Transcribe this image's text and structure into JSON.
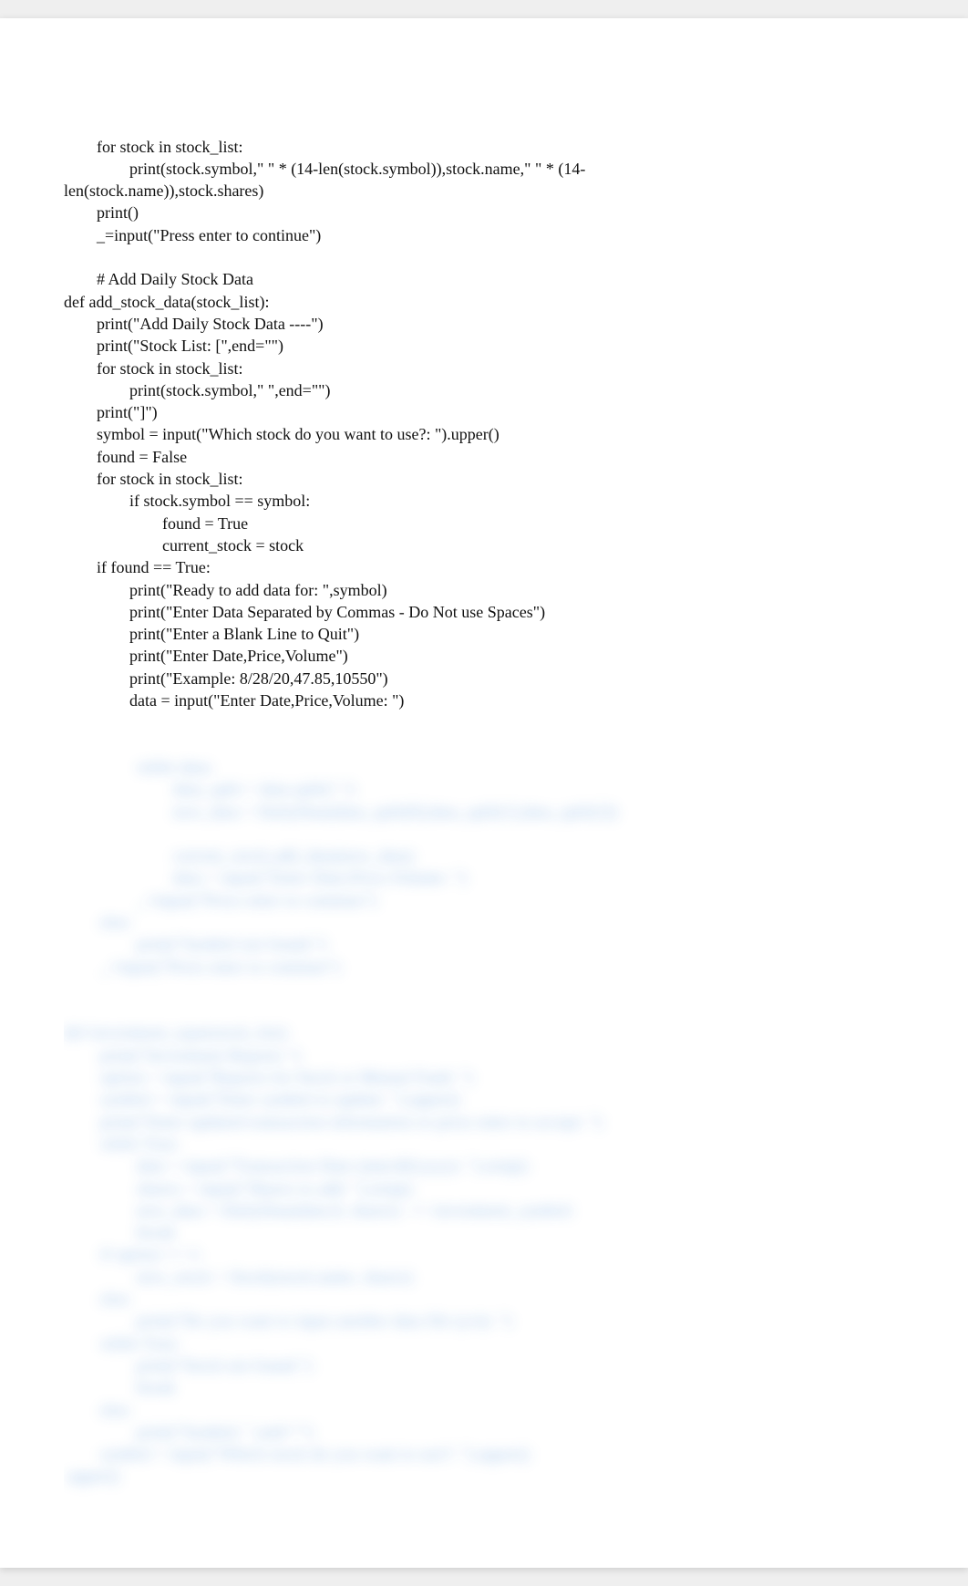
{
  "code": {
    "clear_lines": [
      "        for stock in stock_list:",
      "                print(stock.symbol,\" \" * (14-len(stock.symbol)),stock.name,\" \" * (14-",
      "len(stock.name)),stock.shares)",
      "        print()",
      "        _=input(\"Press enter to continue\")",
      "",
      "        # Add Daily Stock Data",
      "def add_stock_data(stock_list):",
      "        print(\"Add Daily Stock Data ----\")",
      "        print(\"Stock List: [\",end=\"\")",
      "        for stock in stock_list:",
      "                print(stock.symbol,\" \",end=\"\")",
      "        print(\"]\")",
      "        symbol = input(\"Which stock do you want to use?: \").upper()",
      "        found = False",
      "        for stock in stock_list:",
      "                if stock.symbol == symbol:",
      "                        found = True",
      "                        current_stock = stock",
      "        if found == True:",
      "                print(\"Ready to add data for: \",symbol)",
      "                print(\"Enter Data Separated by Commas - Do Not use Spaces\")",
      "                print(\"Enter a Blank Line to Quit\")",
      "                print(\"Enter Date,Price,Volume\")",
      "                print(\"Example: 8/28/20,47.85,10550\")",
      "                data = input(\"Enter Date,Price,Volume: \")"
    ],
    "blurred_lines": [
      "                while data:",
      "                        data_split = data.split(\",\")",
      "                        new_data = DailyData(data_split[0],data_split[1],data_split[2])",
      "",
      "                        current_stock.add_data(new_data)",
      "                        data = input(\"Enter Date,Price,Volume: \")",
      "                _=input(\"Press enter to continue\")",
      "        else:",
      "                print(\"Symbol not found.\")",
      "        _=input(\"Press enter to continue\")",
      "",
      "",
      "def investment_type(stock_list):",
      "        print(\"Investment Reports \")",
      "        option = input(\"Reports for Stock or Mutual Fund: \")",
      "        symbol = input(\"Enter symbol to update: \").upper()",
      "        print(\"Enter updated transaction information or press enter to accept: \")",
      "        while True:",
      "                date = input(\"Transaction Date (mm/dd/yyyy): \").strip()",
      "                shares = input(\"Shares to add: \").strip()",
      "                new_data = DailyData(date,0, shares)  == investment_symbol:",
      "                break",
      "        if option == 1:",
      "                new_stock = Stock(stock.name, shares)",
      "        else:",
      "                print(\"Do you want to input another data file (y/n): \")",
      "        while True:",
      "                print(\"Stock not found.\")",
      "                break",
      "        else:",
      "                print(\"Symbol: \",end=\"\")",
      "        symbol = input(\"Which stock do you want to use?: \").upper()",
      ".upper()"
    ]
  }
}
